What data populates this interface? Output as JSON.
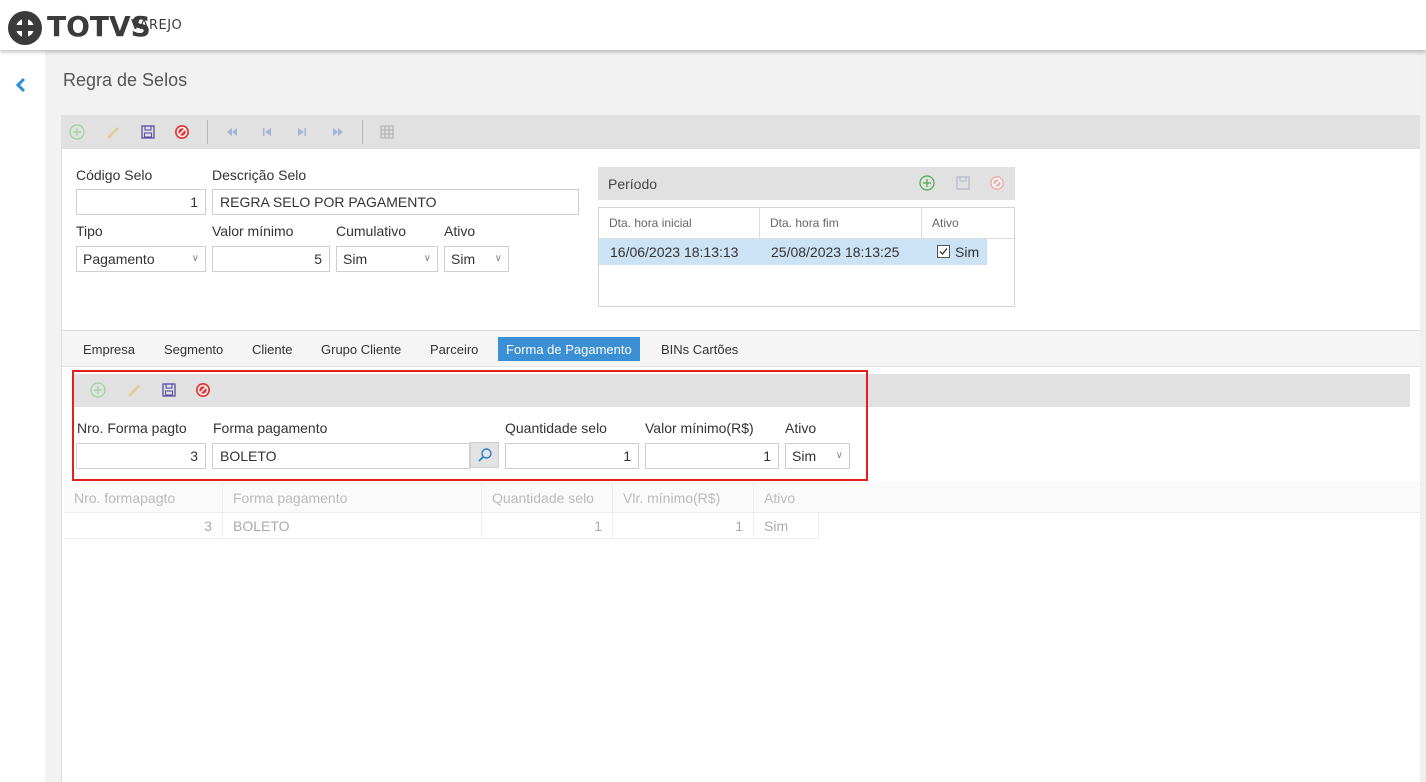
{
  "brand": {
    "name": "TOTVS",
    "sub": "VAREJO"
  },
  "page": {
    "title": "Regra de Selos"
  },
  "icons": {
    "add": "plus-circle-icon",
    "edit": "pencil-icon",
    "save": "floppy-icon",
    "cancel": "cancel-icon",
    "first": "first-page-icon",
    "prev": "previous-icon",
    "next": "next-icon",
    "last": "last-page-icon",
    "grid": "grid-icon",
    "search": "magnifier-icon",
    "back": "chevron-left-icon"
  },
  "colors": {
    "accent": "#3b8fd4",
    "highlight": "#cce2f5",
    "alert": "#e32020"
  },
  "form": {
    "codigo_label": "Código Selo",
    "codigo_value": "1",
    "descricao_label": "Descrição Selo",
    "descricao_value": "REGRA SELO POR PAGAMENTO",
    "tipo_label": "Tipo",
    "tipo_value": "Pagamento",
    "valor_label": "Valor mínimo",
    "valor_value": "5",
    "cumulativo_label": "Cumulativo",
    "cumulativo_value": "Sim",
    "ativo_label": "Ativo",
    "ativo_value": "Sim"
  },
  "periodo": {
    "title": "Período",
    "columns": [
      "Dta. hora inicial",
      "Dta. hora fim",
      "Ativo"
    ],
    "rows": [
      {
        "inicio": "16/06/2023 18:13:13",
        "fim": "25/08/2023 18:13:25",
        "ativo": "Sim",
        "checked": true
      }
    ]
  },
  "tabs": [
    {
      "label": "Empresa"
    },
    {
      "label": "Segmento"
    },
    {
      "label": "Cliente"
    },
    {
      "label": "Grupo Cliente"
    },
    {
      "label": "Parceiro"
    },
    {
      "label": "Forma de Pagamento",
      "active": true
    },
    {
      "label": "BINs Cartões"
    }
  ],
  "pagto_form": {
    "nro_label": "Nro. Forma pagto",
    "nro_value": "3",
    "forma_label": "Forma pagamento",
    "forma_value": "BOLETO",
    "qtd_label": "Quantidade selo",
    "qtd_value": "1",
    "valor_label": "Valor mínimo(R$)",
    "valor_value": "1",
    "ativo_label": "Ativo",
    "ativo_value": "Sim"
  },
  "pagto_grid": {
    "columns": [
      "Nro. formapagto",
      "Forma pagamento",
      "Quantidade selo",
      "Vlr. mínimo(R$)",
      "Ativo"
    ],
    "rows": [
      {
        "nro": "3",
        "forma": "BOLETO",
        "qtd": "1",
        "valor": "1",
        "ativo": "Sim"
      }
    ]
  }
}
